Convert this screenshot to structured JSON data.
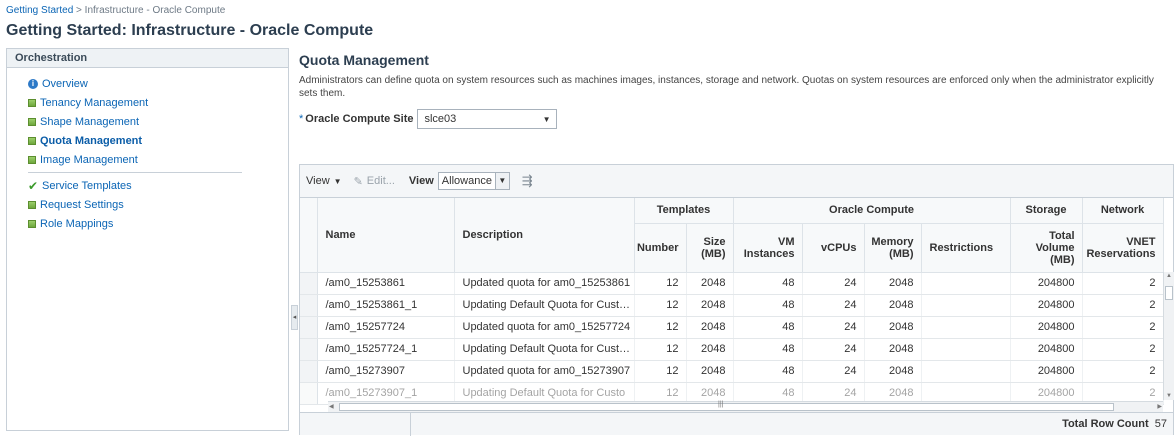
{
  "breadcrumb": {
    "link": "Getting Started",
    "separator": " > ",
    "current": "Infrastructure - Oracle Compute"
  },
  "page_title": "Getting Started: Infrastructure - Oracle Compute",
  "left": {
    "header": "Orchestration",
    "items": [
      {
        "label": "Overview",
        "icon": "info-circle-icon"
      },
      {
        "label": "Tenancy Management",
        "icon": "green-square-icon"
      },
      {
        "label": "Shape Management",
        "icon": "green-square-icon"
      },
      {
        "label": "Quota Management",
        "icon": "green-square-icon",
        "active": true
      },
      {
        "label": "Image Management",
        "icon": "green-square-icon"
      }
    ],
    "items2": [
      {
        "label": "Service Templates",
        "icon": "checkmark-icon"
      },
      {
        "label": "Request Settings",
        "icon": "green-square-icon"
      },
      {
        "label": "Role Mappings",
        "icon": "green-square-icon"
      }
    ]
  },
  "main": {
    "title": "Quota Management",
    "description": "Administrators can define quota on system resources such as machines images, instances, storage and network. Quotas on system resources are enforced only when the administrator explicitly sets them.",
    "site_label": "Oracle Compute Site",
    "site_required": "*",
    "site_value": "slce03"
  },
  "toolbar": {
    "view_menu": "View",
    "edit": "Edit...",
    "view_label": "View",
    "view_select": "Allowance"
  },
  "table": {
    "group_headers": [
      "Templates",
      "Oracle Compute",
      "Storage",
      "Network"
    ],
    "columns": {
      "name": "Name",
      "description": "Description",
      "number": "Number",
      "size": "Size (MB)",
      "vm": "VM Instances",
      "vcpus": "vCPUs",
      "memory": "Memory (MB)",
      "restrictions": "Restrictions",
      "volume": "Total Volume (MB)",
      "vnet": "VNET Reservations"
    },
    "rows": [
      {
        "name": "/am0_15253861",
        "description": "Updated quota for am0_15253861",
        "number": "12",
        "size": "2048",
        "vm": "48",
        "vcpus": "24",
        "memory": "2048",
        "restrictions": "",
        "volume": "204800",
        "vnet": "2"
      },
      {
        "name": "/am0_15253861_1",
        "description": "Updating Default Quota for Custo...",
        "number": "12",
        "size": "2048",
        "vm": "48",
        "vcpus": "24",
        "memory": "2048",
        "restrictions": "",
        "volume": "204800",
        "vnet": "2"
      },
      {
        "name": "/am0_15257724",
        "description": "Updated quota for am0_15257724",
        "number": "12",
        "size": "2048",
        "vm": "48",
        "vcpus": "24",
        "memory": "2048",
        "restrictions": "",
        "volume": "204800",
        "vnet": "2"
      },
      {
        "name": "/am0_15257724_1",
        "description": "Updating Default Quota for Custo...",
        "number": "12",
        "size": "2048",
        "vm": "48",
        "vcpus": "24",
        "memory": "2048",
        "restrictions": "",
        "volume": "204800",
        "vnet": "2"
      },
      {
        "name": "/am0_15273907",
        "description": "Updated quota for am0_15273907",
        "number": "12",
        "size": "2048",
        "vm": "48",
        "vcpus": "24",
        "memory": "2048",
        "restrictions": "",
        "volume": "204800",
        "vnet": "2"
      },
      {
        "name": "/am0_15273907_1",
        "description": "Updating Default Quota for Custo",
        "number": "12",
        "size": "2048",
        "vm": "48",
        "vcpus": "24",
        "memory": "2048",
        "restrictions": "",
        "volume": "204800",
        "vnet": "2"
      }
    ]
  },
  "footer": {
    "row_count_label": "Total Row Count",
    "row_count": "57"
  }
}
